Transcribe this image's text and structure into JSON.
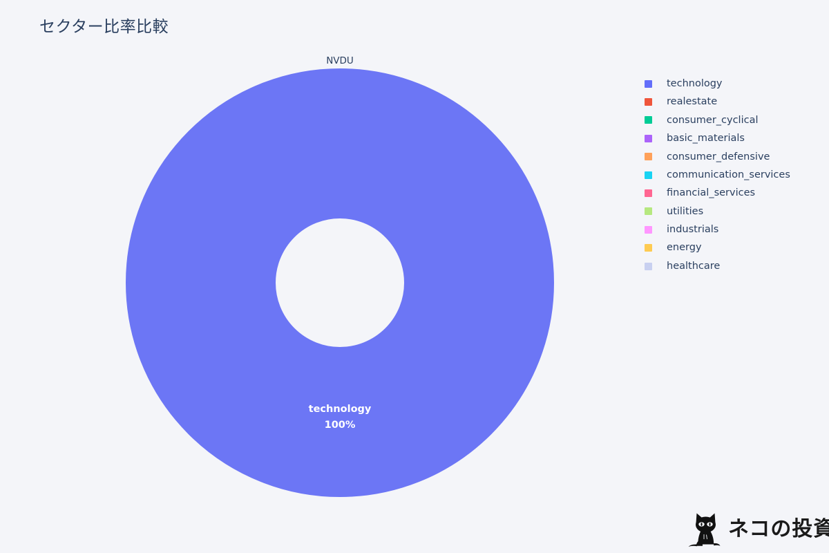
{
  "page": {
    "title": "セクター比率比較",
    "background_color": "#f4f5f9",
    "text_color": "#2a3f5f"
  },
  "watermark": {
    "text": "ネコの投資",
    "icon": "black-cat-silhouette-icon",
    "color": "#1a1a1a"
  },
  "chart_data": {
    "type": "pie",
    "variant": "donut",
    "title": "セクター比率比較",
    "subtitle": "NVDU",
    "hole": 0.3,
    "labels": [
      "technology"
    ],
    "values": [
      100
    ],
    "slice_colors": [
      "#6c76f5"
    ],
    "slice_labels": [
      {
        "name": "technology",
        "percent": "100%"
      }
    ],
    "legend": {
      "position": "right",
      "entries": [
        {
          "label": "technology",
          "color": "#636efa"
        },
        {
          "label": "realestate",
          "color": "#ef553b"
        },
        {
          "label": "consumer_cyclical",
          "color": "#00cc96"
        },
        {
          "label": "basic_materials",
          "color": "#ab63fa"
        },
        {
          "label": "consumer_defensive",
          "color": "#ffa15a"
        },
        {
          "label": "communication_services",
          "color": "#19d3f3"
        },
        {
          "label": "financial_services",
          "color": "#ff6692"
        },
        {
          "label": "utilities",
          "color": "#b6e880"
        },
        {
          "label": "industrials",
          "color": "#ff97ff"
        },
        {
          "label": "energy",
          "color": "#fecb52"
        },
        {
          "label": "healthcare",
          "color": "#c8d0f0"
        }
      ]
    }
  }
}
